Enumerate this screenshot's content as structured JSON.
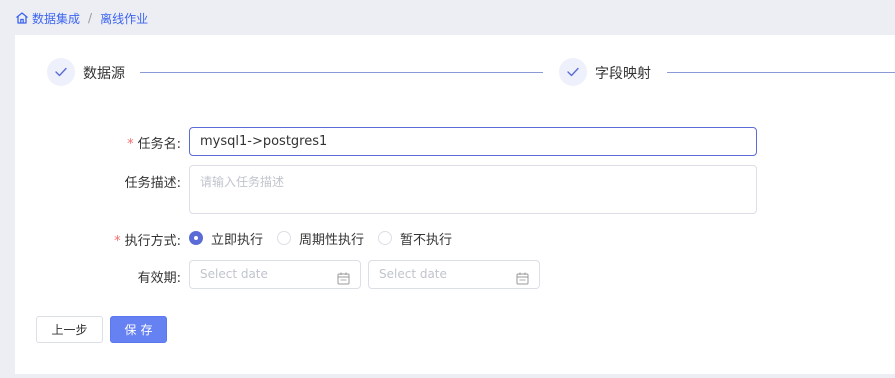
{
  "breadcrumb": {
    "items": [
      "数据集成",
      "离线作业"
    ],
    "separator": "/"
  },
  "steps": [
    {
      "title": "数据源",
      "status": "done"
    },
    {
      "title": "字段映射",
      "status": "done"
    }
  ],
  "form": {
    "task_name": {
      "label": "任务名:",
      "required": true,
      "value": "mysql1->postgres1"
    },
    "task_desc": {
      "label": "任务描述:",
      "required": false,
      "placeholder": "请输入任务描述",
      "value": ""
    },
    "exec_mode": {
      "label": "执行方式:",
      "required": true,
      "options": [
        "立即执行",
        "周期性执行",
        "暂不执行"
      ],
      "selected": "立即执行"
    },
    "validity": {
      "label": "有效期:",
      "start_placeholder": "Select date",
      "end_placeholder": "Select date"
    }
  },
  "buttons": {
    "prev": "上一步",
    "save": "保存"
  },
  "colors": {
    "accent": "#5b6cd6",
    "primary_button": "#6681f2",
    "link": "#3c64f0",
    "required": "#f56c6c"
  },
  "icons": {
    "home": "home-icon",
    "step_done": "check-icon",
    "calendar": "calendar-icon"
  }
}
